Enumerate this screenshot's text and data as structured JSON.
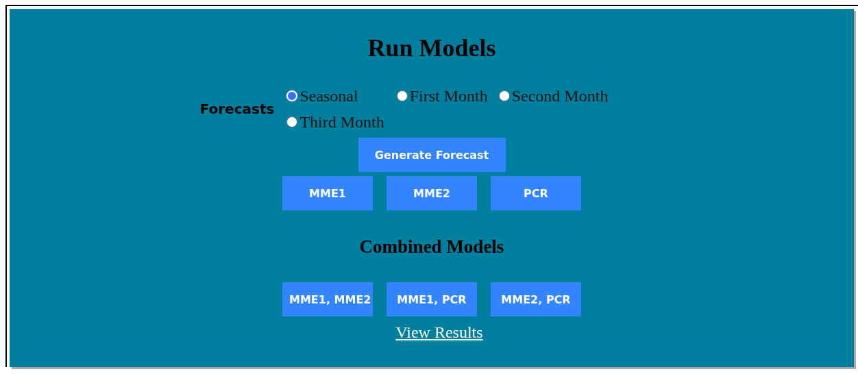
{
  "title": "Run Models",
  "forecasts": {
    "label": "Forecasts",
    "options": [
      {
        "label": "Seasonal",
        "selected": true
      },
      {
        "label": "First Month",
        "selected": false
      },
      {
        "label": "Second Month",
        "selected": false
      },
      {
        "label": "Third Month",
        "selected": false
      }
    ]
  },
  "generate_button": "Generate Forecast",
  "model_buttons": [
    "MME1",
    "MME2",
    "PCR"
  ],
  "combined_heading": "Combined Models",
  "combined_buttons": [
    "MME1, MME2",
    "MME1, PCR",
    "MME2, PCR"
  ],
  "link": "View Results"
}
